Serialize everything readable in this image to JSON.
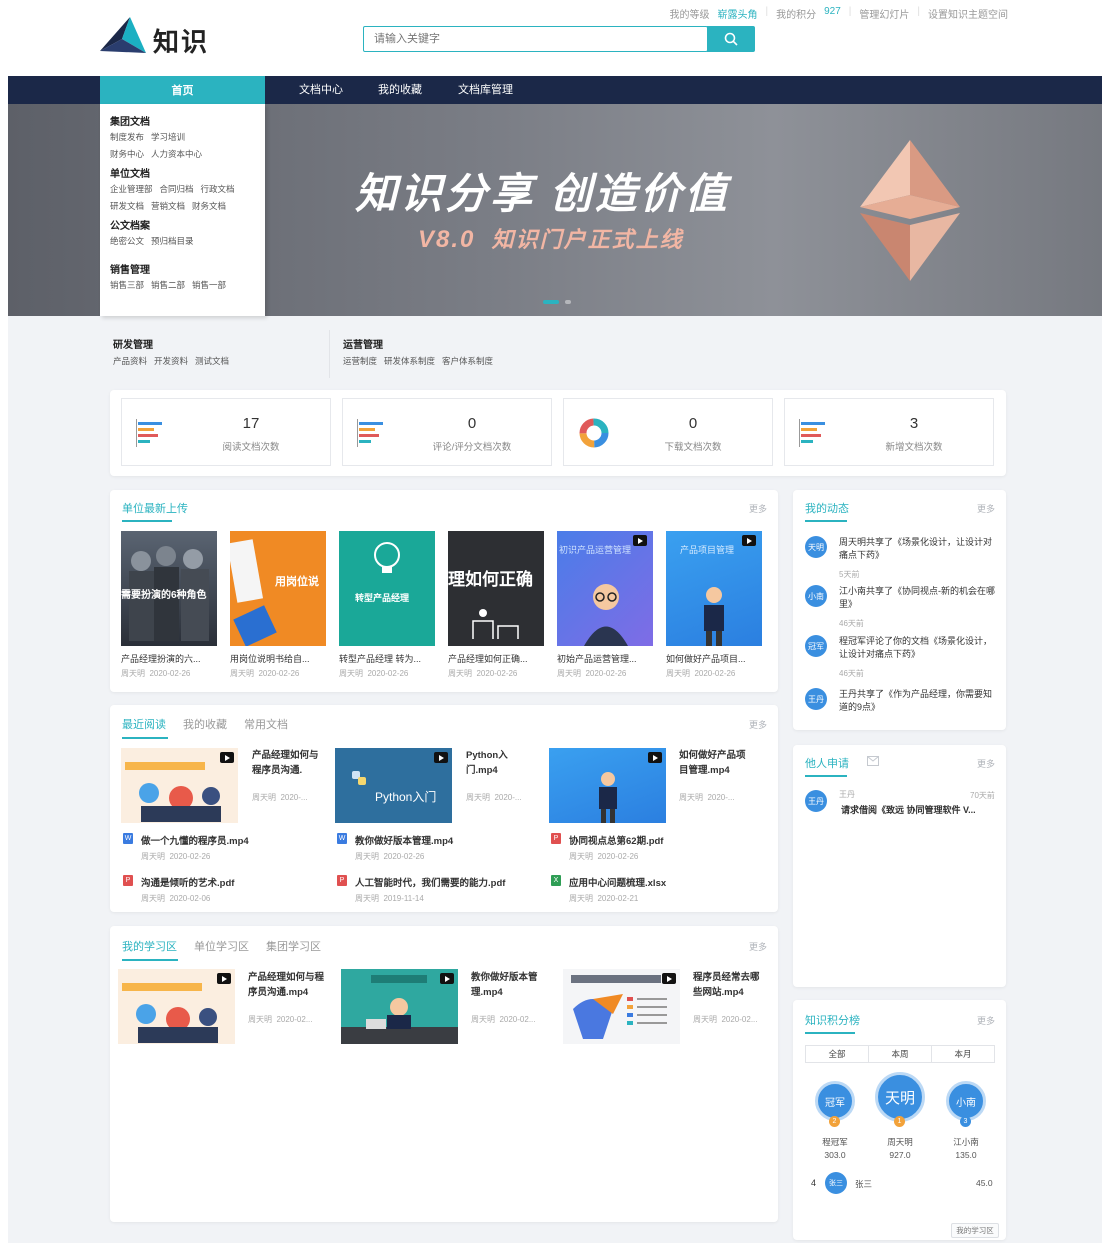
{
  "header": {
    "logo_text": "知识",
    "search_placeholder": "请输入关键字",
    "top_links": {
      "level_label": "我的等级",
      "level_value": "崭露头角",
      "points_label": "我的积分",
      "points_value": "927",
      "manage": "管理幻灯片",
      "settings": "设置知识主题空间"
    }
  },
  "nav": {
    "home": "首页",
    "items": [
      "文档中心",
      "我的收藏",
      "文档库管理"
    ]
  },
  "menu": [
    {
      "title": "集团文档",
      "rows": [
        [
          "制度发布",
          "学习培训"
        ],
        [
          "财务中心",
          "人力资本中心"
        ]
      ]
    },
    {
      "title": "单位文档",
      "rows": [
        [
          "企业管理部",
          "合同归档",
          "行政文档"
        ],
        [
          "研发文档",
          "营销文档",
          "财务文档"
        ]
      ]
    },
    {
      "title": "公文档案",
      "rows": [
        [
          "绝密公文",
          "预归档目录"
        ]
      ]
    },
    {
      "title": "销售管理",
      "rows": [
        [
          "销售三部",
          "销售二部",
          "销售一部"
        ]
      ]
    }
  ],
  "banner": {
    "title": "知识分享  创造价值",
    "version": "V8.0",
    "subtitle": "知识门户正式上线"
  },
  "categories": [
    {
      "title": "研发管理",
      "items": [
        "产品资料",
        "开发资料",
        "测试文档"
      ]
    },
    {
      "title": "运营管理",
      "items": [
        "运营制度",
        "研发体系制度",
        "客户体系制度"
      ]
    }
  ],
  "stats": [
    {
      "value": "17",
      "label": "阅读文档次数"
    },
    {
      "value": "0",
      "label": "评论/评分文档次数"
    },
    {
      "value": "0",
      "label": "下载文档次数"
    },
    {
      "value": "3",
      "label": "新增文档次数"
    }
  ],
  "uploads": {
    "title": "单位最新上传",
    "more": "更多",
    "items": [
      {
        "caption": "产品经理扮演的六...",
        "author": "周天明",
        "date": "2020-02-26",
        "overlay": "需要扮演的6种角色"
      },
      {
        "caption": "用岗位说明书给自...",
        "author": "周天明",
        "date": "2020-02-26",
        "overlay": "用岗位说"
      },
      {
        "caption": "转型产品经理 转为...",
        "author": "周天明",
        "date": "2020-02-26",
        "overlay": "转型产品经理"
      },
      {
        "caption": "产品经理如何正确...",
        "author": "周天明",
        "date": "2020-02-26",
        "overlay": "理如何正确"
      },
      {
        "caption": "初始产品运营管理...",
        "author": "周天明",
        "date": "2020-02-26",
        "overlay": "初识产品运营管理"
      },
      {
        "caption": "如何做好产品项目...",
        "author": "周天明",
        "date": "2020-02-26",
        "overlay": "产品项目管理"
      }
    ]
  },
  "recent": {
    "tabs": [
      "最近阅读",
      "我的收藏",
      "常用文档"
    ],
    "more": "更多",
    "videos": [
      {
        "title": "产品经理如何与程序员沟通.",
        "author": "周天明",
        "date": "2020-..."
      },
      {
        "title": "Python入门.mp4",
        "author": "周天明",
        "date": "2020-...",
        "overlay": "Python入门"
      },
      {
        "title": "如何做好产品项目管理.mp4",
        "author": "周天明",
        "date": "2020-..."
      }
    ],
    "files": [
      {
        "type": "doc",
        "name": "做一个九懂的程序员.mp4",
        "author": "周天明",
        "date": "2020-02-26"
      },
      {
        "type": "doc",
        "name": "教你做好版本管理.mp4",
        "author": "周天明",
        "date": "2020-02-26"
      },
      {
        "type": "pdf",
        "name": "协同视点总第62期.pdf",
        "author": "周天明",
        "date": "2020-02-26"
      },
      {
        "type": "pdf",
        "name": "沟通是倾听的艺术.pdf",
        "author": "周天明",
        "date": "2020-02-06"
      },
      {
        "type": "pdf",
        "name": "人工智能时代，我们需要的能力.pdf",
        "author": "周天明",
        "date": "2019-11-14"
      },
      {
        "type": "xls",
        "name": "应用中心问题梳理.xlsx",
        "author": "周天明",
        "date": "2020-02-21"
      }
    ]
  },
  "study": {
    "tabs": [
      "我的学习区",
      "单位学习区",
      "集团学习区"
    ],
    "more": "更多",
    "videos": [
      {
        "title": "产品经理如何与程序员沟通.mp4",
        "author": "周天明",
        "date": "2020-02..."
      },
      {
        "title": "教你做好版本管理.mp4",
        "author": "周天明",
        "date": "2020-02..."
      },
      {
        "title": "程序员经常去哪些网站.mp4",
        "author": "周天明",
        "date": "2020-02..."
      }
    ]
  },
  "activity": {
    "title": "我的动态",
    "more": "更多",
    "items": [
      {
        "avatar": "天明",
        "text": "周天明共享了《场景化设计，让设计对痛点下药》",
        "time": "5天前"
      },
      {
        "avatar": "小南",
        "text": "江小南共享了《协同视点-新的机会在哪里》",
        "time": "46天前"
      },
      {
        "avatar": "冠军",
        "text": "程冠军评论了你的文档《场景化设计，让设计对痛点下药》",
        "time": "46天前"
      },
      {
        "avatar": "王丹",
        "text": "王丹共享了《作为产品经理，你需要知道的9点》",
        "time": ""
      }
    ]
  },
  "requests": {
    "title": "他人申请",
    "more": "更多",
    "items": [
      {
        "avatar": "王丹",
        "name": "王丹",
        "time": "70天前",
        "text": "请求借阅《致远 协同管理软件 V..."
      }
    ]
  },
  "ranking": {
    "title": "知识积分榜",
    "more": "更多",
    "tabs": [
      "全部",
      "本周",
      "本月"
    ],
    "top": [
      {
        "avatar": "冠军",
        "rank": "2",
        "name": "程冠军",
        "score": "303.0"
      },
      {
        "avatar": "天明",
        "rank": "1",
        "name": "周天明",
        "score": "927.0"
      },
      {
        "avatar": "小南",
        "rank": "3",
        "name": "江小南",
        "score": "135.0"
      }
    ],
    "fourth": {
      "rank": "4",
      "avatar": "张三",
      "name": "张三",
      "score": "45.0"
    },
    "footer_btn": "我的学习区"
  },
  "colors": {
    "accent": "#2bb3c0",
    "navy": "#1b2848",
    "avatar": "#3a8fe0"
  }
}
